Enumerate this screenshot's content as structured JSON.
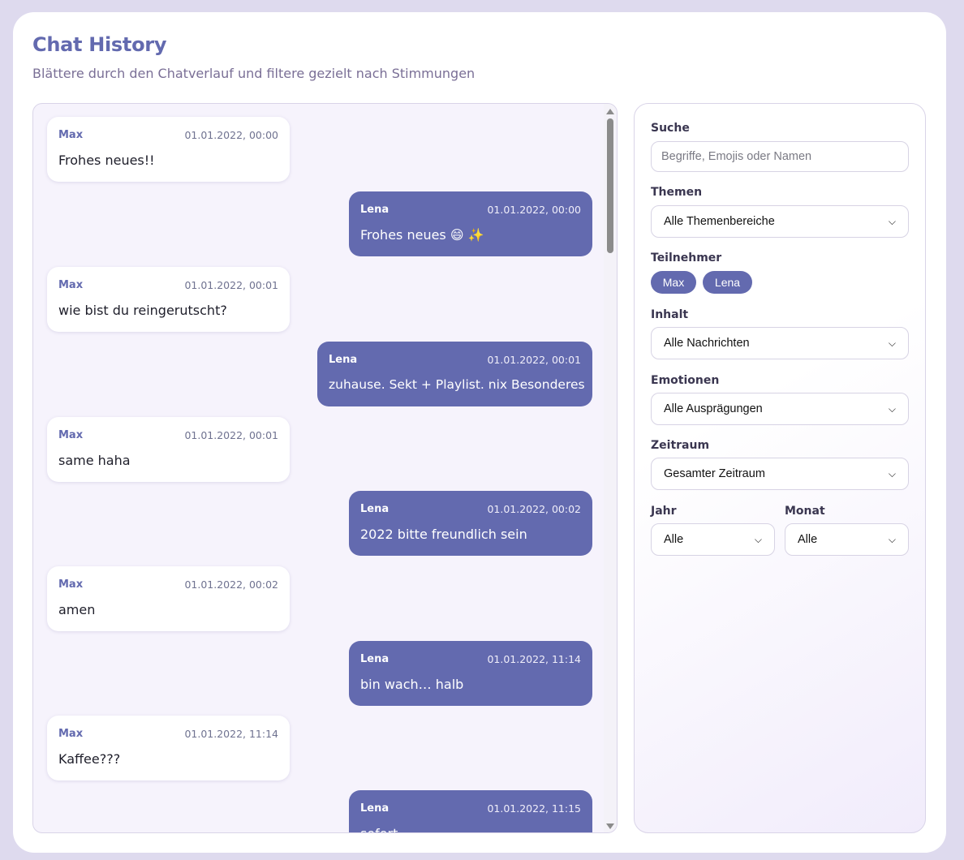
{
  "header": {
    "title": "Chat History",
    "subtitle": "Blättere durch den Chatverlauf und filtere gezielt nach Stimmungen"
  },
  "messages": [
    {
      "sender": "Max",
      "time": "01.01.2022, 00:00",
      "text": "Frohes neues!!",
      "direction": "in"
    },
    {
      "sender": "Lena",
      "time": "01.01.2022, 00:00",
      "text": "Frohes neues 😄 ✨",
      "direction": "out"
    },
    {
      "sender": "Max",
      "time": "01.01.2022, 00:01",
      "text": "wie bist du reingerutscht?",
      "direction": "in"
    },
    {
      "sender": "Lena",
      "time": "01.01.2022, 00:01",
      "text": "zuhause. Sekt + Playlist. nix Besonderes",
      "direction": "out"
    },
    {
      "sender": "Max",
      "time": "01.01.2022, 00:01",
      "text": "same haha",
      "direction": "in"
    },
    {
      "sender": "Lena",
      "time": "01.01.2022, 00:02",
      "text": "2022 bitte freundlich sein",
      "direction": "out"
    },
    {
      "sender": "Max",
      "time": "01.01.2022, 00:02",
      "text": "amen",
      "direction": "in"
    },
    {
      "sender": "Lena",
      "time": "01.01.2022, 11:14",
      "text": "bin wach… halb",
      "direction": "out"
    },
    {
      "sender": "Max",
      "time": "01.01.2022, 11:14",
      "text": "Kaffee???",
      "direction": "in"
    },
    {
      "sender": "Lena",
      "time": "01.01.2022, 11:15",
      "text": "sofort",
      "direction": "out"
    }
  ],
  "filters": {
    "search": {
      "label": "Suche",
      "placeholder": "Begriffe, Emojis oder Namen",
      "value": ""
    },
    "topics": {
      "label": "Themen",
      "selected": "Alle Themenbereiche"
    },
    "participants": {
      "label": "Teilnehmer",
      "chips": [
        "Max",
        "Lena"
      ]
    },
    "content": {
      "label": "Inhalt",
      "selected": "Alle Nachrichten"
    },
    "emotions": {
      "label": "Emotionen",
      "selected": "Alle Ausprägungen"
    },
    "period": {
      "label": "Zeitraum",
      "selected": "Gesamter Zeitraum"
    },
    "year": {
      "label": "Jahr",
      "selected": "Alle"
    },
    "month": {
      "label": "Monat",
      "selected": "Alle"
    }
  },
  "colors": {
    "accent": "#636aaf",
    "background": "#dedaee",
    "chat_panel": "#f6f3fc"
  }
}
